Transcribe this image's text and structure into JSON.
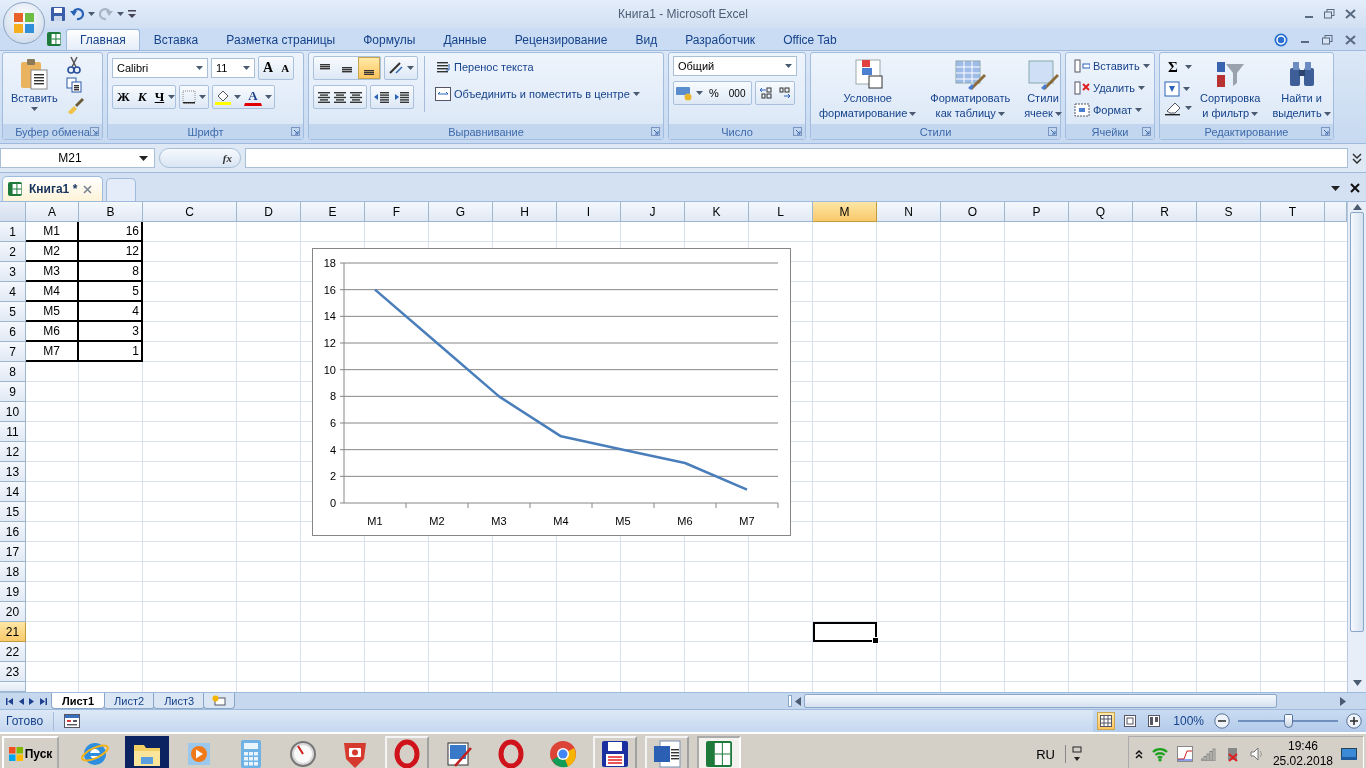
{
  "window": {
    "title": "Книга1 - Microsoft Excel"
  },
  "ribbon_tabs": [
    {
      "label": "Главная",
      "selected": true
    },
    {
      "label": "Вставка",
      "selected": false
    },
    {
      "label": "Разметка страницы",
      "selected": false
    },
    {
      "label": "Формулы",
      "selected": false
    },
    {
      "label": "Данные",
      "selected": false
    },
    {
      "label": "Рецензирование",
      "selected": false
    },
    {
      "label": "Вид",
      "selected": false
    },
    {
      "label": "Разработчик",
      "selected": false
    },
    {
      "label": "Office Tab",
      "selected": false
    }
  ],
  "clipboard": {
    "paste": "Вставить",
    "label": "Буфер обмена"
  },
  "font": {
    "name": "Calibri",
    "size": "11",
    "grow": "A",
    "shrink": "A",
    "bold": "Ж",
    "italic": "К",
    "underline": "Ч",
    "color_letter": "A",
    "label": "Шрифт"
  },
  "alignment": {
    "vertical": [
      {
        "selected": false
      },
      {
        "selected": false
      },
      {
        "selected": true
      }
    ],
    "wrap_text": "Перенос текста",
    "merge": "Объединить и поместить в центре",
    "label": "Выравнивание"
  },
  "number": {
    "format": "Общий",
    "percent": "%",
    "thousands": "000",
    "label": "Число"
  },
  "styles": {
    "buttons": [
      [
        "Условное",
        "форматирование"
      ],
      [
        "Форматировать",
        "как таблицу"
      ],
      [
        "Стили",
        "ячеек"
      ]
    ],
    "label": "Стили"
  },
  "cells": {
    "buttons": [
      "Вставить",
      "Удалить",
      "Формат"
    ],
    "label": "Ячейки"
  },
  "editing": {
    "autosum": "Σ",
    "buttons": [
      [
        "Сортировка",
        "и фильтр"
      ],
      [
        "Найти и",
        "выделить"
      ]
    ],
    "label": "Редактирование"
  },
  "formula_bar": {
    "name_box": "M21",
    "fx": "fx"
  },
  "document_tabs": [
    {
      "label": "Книга1 *",
      "selected": true
    }
  ],
  "sheet": {
    "columns": [
      {
        "label": "A",
        "selected": false
      },
      {
        "label": "B",
        "selected": false
      },
      {
        "label": "C",
        "selected": false
      },
      {
        "label": "D",
        "selected": false
      },
      {
        "label": "E",
        "selected": false
      },
      {
        "label": "F",
        "selected": false
      },
      {
        "label": "G",
        "selected": false
      },
      {
        "label": "H",
        "selected": false
      },
      {
        "label": "I",
        "selected": false
      },
      {
        "label": "J",
        "selected": false
      },
      {
        "label": "K",
        "selected": false
      },
      {
        "label": "L",
        "selected": false
      },
      {
        "label": "M",
        "selected": true
      },
      {
        "label": "N",
        "selected": false
      },
      {
        "label": "O",
        "selected": false
      },
      {
        "label": "P",
        "selected": false
      },
      {
        "label": "Q",
        "selected": false
      },
      {
        "label": "R",
        "selected": false
      },
      {
        "label": "S",
        "selected": false
      },
      {
        "label": "T",
        "selected": false
      }
    ],
    "rows": [
      {
        "number": "1",
        "selected": false,
        "cells": [
          "M1",
          "16"
        ]
      },
      {
        "number": "2",
        "selected": false,
        "cells": [
          "M2",
          "12"
        ]
      },
      {
        "number": "3",
        "selected": false,
        "cells": [
          "M3",
          "8"
        ]
      },
      {
        "number": "4",
        "selected": false,
        "cells": [
          "M4",
          "5"
        ]
      },
      {
        "number": "5",
        "selected": false,
        "cells": [
          "M5",
          "4"
        ]
      },
      {
        "number": "6",
        "selected": false,
        "cells": [
          "M6",
          "3"
        ]
      },
      {
        "number": "7",
        "selected": false,
        "cells": [
          "M7",
          "1"
        ]
      },
      {
        "number": "8",
        "selected": false
      },
      {
        "number": "9",
        "selected": false
      },
      {
        "number": "10",
        "selected": false
      },
      {
        "number": "11",
        "selected": false
      },
      {
        "number": "12",
        "selected": false
      },
      {
        "number": "13",
        "selected": false
      },
      {
        "number": "14",
        "selected": false
      },
      {
        "number": "15",
        "selected": false
      },
      {
        "number": "16",
        "selected": false
      },
      {
        "number": "17",
        "selected": false
      },
      {
        "number": "18",
        "selected": false
      },
      {
        "number": "19",
        "selected": false
      },
      {
        "number": "20",
        "selected": false
      },
      {
        "number": "21",
        "selected": true
      },
      {
        "number": "22",
        "selected": false
      },
      {
        "number": "23",
        "selected": false
      }
    ]
  },
  "chart": {
    "chart_data": {
      "type": "line",
      "categories": [
        "M1",
        "M2",
        "M3",
        "M4",
        "M5",
        "M6",
        "M7"
      ],
      "series": [
        {
          "color": "#4a7ebb",
          "values": [
            16,
            12,
            8,
            5,
            4,
            3,
            1
          ]
        }
      ],
      "grid": true,
      "ylim": [
        0,
        18
      ],
      "yticks": [
        0,
        2,
        4,
        6,
        8,
        10,
        12,
        14,
        16,
        18
      ]
    }
  },
  "sheet_tabs": [
    {
      "label": "Лист1",
      "selected": true
    },
    {
      "label": "Лист2",
      "selected": false
    },
    {
      "label": "Лист3",
      "selected": false
    }
  ],
  "status_bar": {
    "text": "Готово",
    "views": [
      {
        "selected": true
      },
      {
        "selected": false
      },
      {
        "selected": false
      }
    ],
    "zoom": "100%",
    "zoom_slider": {
      "level": 0.5
    }
  },
  "taskbar": {
    "start": "Пуск",
    "apps": [
      {
        "kind": "browser",
        "open": false,
        "flashing": false,
        "selected": false
      },
      {
        "kind": "folder",
        "open": false,
        "flashing": true,
        "selected": false
      },
      {
        "kind": "media",
        "open": false,
        "flashing": false,
        "selected": false
      },
      {
        "kind": "calculator",
        "open": false,
        "flashing": false,
        "selected": false
      },
      {
        "kind": "gauge",
        "open": false,
        "flashing": false,
        "selected": false
      },
      {
        "kind": "camera",
        "open": false,
        "flashing": false,
        "selected": false
      },
      {
        "kind": "ring",
        "open": true,
        "flashing": false,
        "selected": false
      },
      {
        "kind": "paint",
        "open": false,
        "flashing": false,
        "selected": false
      },
      {
        "kind": "ring",
        "open": false,
        "flashing": false,
        "selected": false
      },
      {
        "kind": "circle-logo",
        "open": false,
        "flashing": false,
        "selected": false
      },
      {
        "kind": "floppy",
        "open": true,
        "flashing": false,
        "selected": false
      },
      {
        "kind": "document",
        "open": true,
        "flashing": false,
        "selected": false
      },
      {
        "kind": "spreadsheet",
        "open": true,
        "flashing": false,
        "selected": true
      }
    ],
    "language": "RU",
    "time": "19:46",
    "date": "25.02.2018"
  }
}
